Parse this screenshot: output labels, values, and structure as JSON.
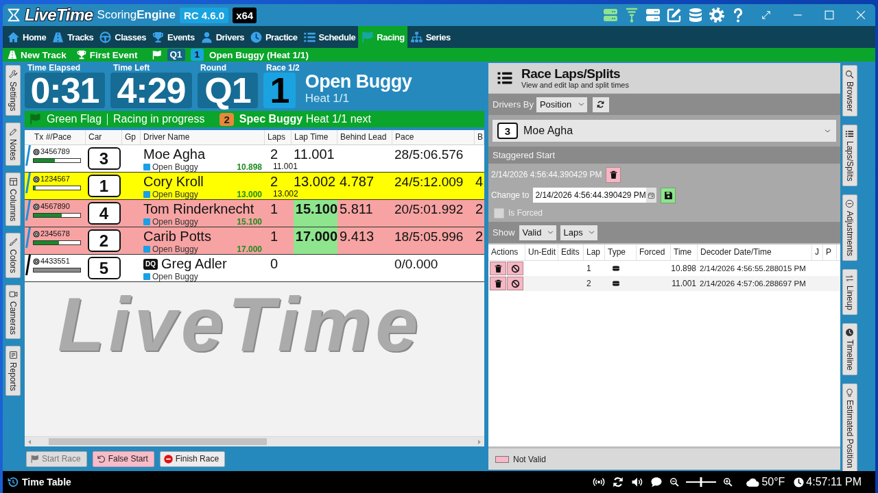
{
  "window": {
    "logo": "LiveTime",
    "product": "Scoring**Engine**",
    "version": "RC 4.6.0",
    "build": "x64"
  },
  "toolbar": [
    {
      "kind": "server",
      "active": true
    },
    {
      "kind": "antenna",
      "active": true
    },
    {
      "kind": "server",
      "active": false
    },
    {
      "kind": "edit",
      "active": false
    },
    {
      "kind": "database",
      "active": false
    },
    {
      "kind": "settings",
      "active": false
    },
    {
      "kind": "help",
      "active": false
    }
  ],
  "window_controls": [
    {
      "kind": "expand"
    },
    {
      "kind": "minimize"
    },
    {
      "kind": "maximize"
    },
    {
      "kind": "close"
    }
  ],
  "nav": [
    {
      "label": "Home",
      "kind": "home",
      "selected": false
    },
    {
      "label": "Tracks",
      "kind": "track",
      "selected": false
    },
    {
      "label": "Classes",
      "kind": "wheel",
      "selected": false
    },
    {
      "label": "Events",
      "kind": "trophy",
      "selected": false
    },
    {
      "label": "Drivers",
      "kind": "person",
      "selected": false
    },
    {
      "label": "Practice",
      "kind": "clock",
      "selected": false
    },
    {
      "label": "Schedule",
      "kind": "list",
      "selected": false
    },
    {
      "label": "Racing",
      "kind": "flag",
      "selected": true
    },
    {
      "label": "Series",
      "kind": "tree",
      "selected": false
    }
  ],
  "breadcrumb": {
    "track": "New Track",
    "event": "First Event",
    "round": "Q1",
    "race": "1",
    "title": "Open Buggy (Heat 1/1)"
  },
  "left_tabs": [
    {
      "label": "Settings",
      "kind": "wrench"
    },
    {
      "label": "Notes",
      "kind": "pencil"
    },
    {
      "label": "Columns",
      "kind": "columns"
    },
    {
      "label": "Colors",
      "kind": "brush"
    },
    {
      "label": "Cameras",
      "kind": "camera"
    },
    {
      "label": "Reports",
      "kind": "report"
    }
  ],
  "race": {
    "elapsed_label": "Time Elapsed",
    "elapsed": "0:31",
    "left_label": "Time Left",
    "left": "4:29",
    "round_label": "Round",
    "round": "Q1",
    "race_label": "Race 1/2",
    "race": "1",
    "class": "Open Buggy",
    "heat": "Heat 1/1"
  },
  "flag_bar": {
    "flag": "Green Flag",
    "status": "Racing in progress",
    "next_number": "2",
    "next": "**Spec Buggy** Heat 1/1 next"
  },
  "standings": {
    "columns": [
      "Tx #/Pace",
      "Car",
      "Gp",
      "Driver Name",
      "Laps",
      "Lap Time",
      "Behind Lead",
      "Pace",
      "B"
    ],
    "rows": [
      {
        "marker": {
          "color": "#1e8fd6"
        },
        "color": "#ffffff",
        "tx": "3456789",
        "level": 0.45,
        "bar_active": true,
        "car": "3",
        "name": "Moe Agha",
        "class": "Open Buggy",
        "best": "10.898",
        "laps": "2",
        "last_lap": "11.001",
        "lap_time": "11.001",
        "lap_time_best": false,
        "pace": "28/5:06.576"
      },
      {
        "marker": {
          "color": "#1e8fd6"
        },
        "color": "#ffff00",
        "tx": "1234567",
        "level": 0.04,
        "bar_active": true,
        "car": "1",
        "name": "Cory Kroll",
        "class": "Open Buggy",
        "best": "13.000",
        "laps": "2",
        "last_lap": "13.002",
        "lap_time": "13.002",
        "lap_time_best": false,
        "behind": "4.787",
        "pace": "24/5:12.009",
        "column_9": "4"
      },
      {
        "marker": {
          "color": "#1e8fd6"
        },
        "color": "#f7a3a3",
        "tx": "4567890",
        "level": 0.6,
        "bar_active": true,
        "car": "4",
        "name": "Tom Rinderknecht",
        "class": "Open Buggy",
        "best": "15.100",
        "laps": "1",
        "lap_time": "15.100",
        "lap_time_best": true,
        "behind": "5.811",
        "pace": "20/5:01.992",
        "column_9": "2"
      },
      {
        "marker": {
          "color": "#1e8fd6"
        },
        "color": "#f7a3a3",
        "tx": "2345678",
        "level": 0.55,
        "bar_active": true,
        "car": "2",
        "name": "Carib Potts",
        "class": "Open Buggy",
        "best": "17.000",
        "laps": "1",
        "lap_time": "17.000",
        "lap_time_best": true,
        "behind": "9.413",
        "pace": "18/5:05.996",
        "column_9": "2"
      },
      {
        "marker": {
          "color": "#000000"
        },
        "color": "#ffffff",
        "tx": "4433551",
        "bar_active": false,
        "car": "5",
        "badge": "DQ",
        "name": "Greg Adler",
        "class": "Open Buggy",
        "laps": "0",
        "lap_time_best": false,
        "pace": "0/0.000"
      }
    ]
  },
  "background_logo": "LiveTime",
  "race_controls": [
    {
      "label": "Start Race",
      "kind": "flag",
      "disabled": true
    },
    {
      "label": "False Start",
      "kind": "undo",
      "disabled": false
    },
    {
      "label": "Finish Race",
      "kind": "stop",
      "disabled": false
    }
  ],
  "laps_panel": {
    "title": "Race Laps/Splits",
    "subtitle": "View and edit lap and split times",
    "drivers_by_label": "Drivers By",
    "drivers_by": "Position",
    "driver_car": "3",
    "driver_name": "Moe Agha",
    "staggered_title": "Staggered Start",
    "staggered_time": "2/14/2026 4:56:44.390429 PM",
    "change_label": "Change to",
    "change_value": "2/14/2026 4:56:44.390429 PM",
    "forced": {
      "label": "Is Forced",
      "checked": false
    },
    "show_label": "Show",
    "show_filter": "Valid",
    "show_type": "Laps",
    "columns": [
      "Actions",
      "Un-Edit",
      "Edits",
      "Lap",
      "Type",
      "Forced",
      "Time",
      "Decoder Date/Time",
      "J",
      "P"
    ],
    "rows": [
      {
        "lap": "1",
        "time": "10.898",
        "decoder_time": "2/14/2026 4:56:55.288015 PM"
      },
      {
        "lap": "2",
        "time": "11.001",
        "decoder_time": "2/14/2026 4:57:06.288697 PM"
      }
    ],
    "legend": {
      "label": "Not Valid",
      "color": "#f8b8c8"
    }
  },
  "right_tabs": [
    {
      "label": "Browser",
      "kind": "search"
    },
    {
      "label": "Laps/Splits",
      "kind": "list"
    },
    {
      "label": "Adjustments",
      "kind": "adjust"
    },
    {
      "label": "Lineup",
      "kind": "swap"
    },
    {
      "label": "Timeline",
      "kind": "clock"
    },
    {
      "label": "Estimated Position",
      "kind": "bulb"
    }
  ],
  "taskbar": {
    "app": "Time Table",
    "zoom": {
      "level": 0.5
    },
    "temperature": "50°F",
    "time": "4:57:11 PM"
  }
}
